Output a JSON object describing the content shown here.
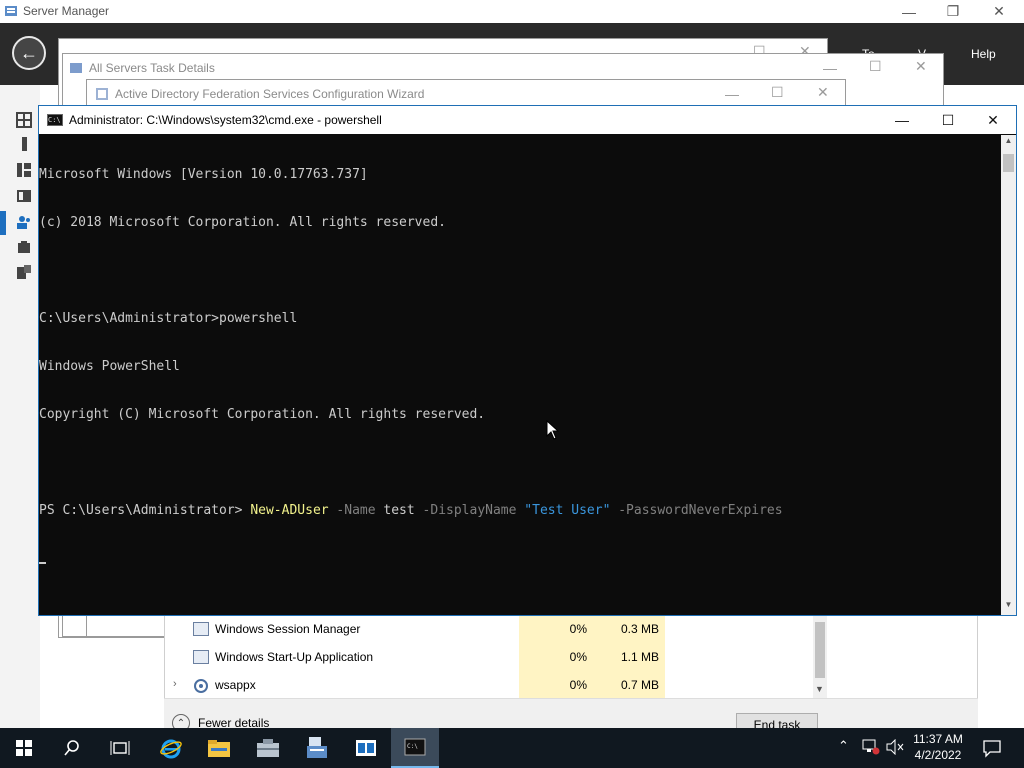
{
  "server_manager": {
    "title": "Server Manager",
    "menu_tools": "To",
    "menu_view": "V",
    "menu_help": "Help"
  },
  "dialogs": {
    "all_servers": {
      "title": "All Servers Task Details"
    },
    "adfs_wizard": {
      "title": "Active Directory Federation Services Configuration Wizard"
    }
  },
  "cmd": {
    "title": "Administrator: C:\\Windows\\system32\\cmd.exe - powershell",
    "lines": [
      "Microsoft Windows [Version 10.0.17763.737]",
      "(c) 2018 Microsoft Corporation. All rights reserved.",
      "",
      "C:\\Users\\Administrator>powershell",
      "Windows PowerShell",
      "Copyright (C) Microsoft Corporation. All rights reserved.",
      ""
    ],
    "prompt": "PS C:\\Users\\Administrator> ",
    "command": "New-ADUser",
    "param_name": " -Name ",
    "name_value": "test",
    "param_display": " -DisplayName ",
    "display_value": "\"Test User\"",
    "param_password": " -PasswordNeverExpires"
  },
  "task_manager": {
    "rows": [
      {
        "name": "Windows Session Manager",
        "cpu": "0%",
        "memory": "0.3 MB"
      },
      {
        "name": "Windows Start-Up Application",
        "cpu": "0%",
        "memory": "1.1 MB"
      },
      {
        "name": "wsappx",
        "cpu": "0%",
        "memory": "0.7 MB"
      }
    ],
    "fewer_details": "Fewer details",
    "end_task": "End task"
  },
  "taskbar": {
    "time": "11:37 AM",
    "date": "4/2/2022",
    "accent": "#76b9ed"
  }
}
